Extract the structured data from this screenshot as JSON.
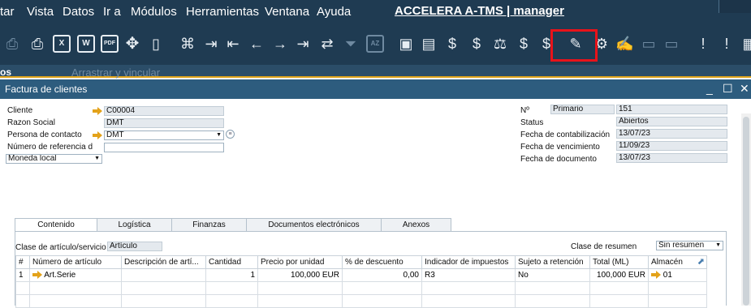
{
  "menubar": {
    "items": [
      "tar",
      "Vista",
      "Datos",
      "Ir a",
      "Módulos",
      "Herramientas",
      "Ventana",
      "Ayuda"
    ],
    "app_title": "ACCELERA A-TMS | manager"
  },
  "strip": {
    "left_text": "os",
    "drag_link": "Arrastrar y vincular"
  },
  "window": {
    "title": "Factura de clientes"
  },
  "header_left": {
    "cliente_label": "Cliente",
    "cliente_value": "C00004",
    "razon_label": "Razon Social",
    "razon_value": "DMT",
    "contacto_label": "Persona de contacto",
    "contacto_value": "DMT",
    "referencia_label": "Número de referencia d",
    "referencia_value": "",
    "moneda_value": "Moneda local"
  },
  "header_right": {
    "numero_label": "Nº",
    "serie_value": "Primario",
    "numero_value": "151",
    "status_label": "Status",
    "status_value": "Abiertos",
    "contab_label": "Fecha de contabilización",
    "contab_value": "13/07/23",
    "venc_label": "Fecha de vencimiento",
    "venc_value": "11/09/23",
    "doc_label": "Fecha de documento",
    "doc_value": "13/07/23"
  },
  "tabs": [
    "Contenido",
    "Logística",
    "Finanzas",
    "Documentos electrónicos",
    "Anexos"
  ],
  "content": {
    "clase_label": "Clase de artículo/servicio",
    "clase_value": "Artículo",
    "resumen_label": "Clase de resumen",
    "resumen_value": "Sin resumen"
  },
  "table": {
    "columns": [
      "#",
      "Número de artículo",
      "Descripción de artí...",
      "Cantidad",
      "Precio por unidad",
      "% de descuento",
      "Indicador de impuestos",
      "Sujeto a retención",
      "Total (ML)",
      "Almacén"
    ],
    "rows": [
      {
        "n": "1",
        "articulo": "Art.Serie",
        "descripcion": "",
        "cantidad": "1",
        "precio": "100,000 EUR",
        "descuento": "0,00",
        "impuesto": "R3",
        "retencion": "No",
        "total": "100,000 EUR",
        "almacen": "01"
      }
    ]
  },
  "colors": {
    "menubar_bg": "#1f3b52",
    "title_bg": "#2d5c7e",
    "highlight": "#e8131a",
    "link_arrow": "#e3a21a"
  }
}
